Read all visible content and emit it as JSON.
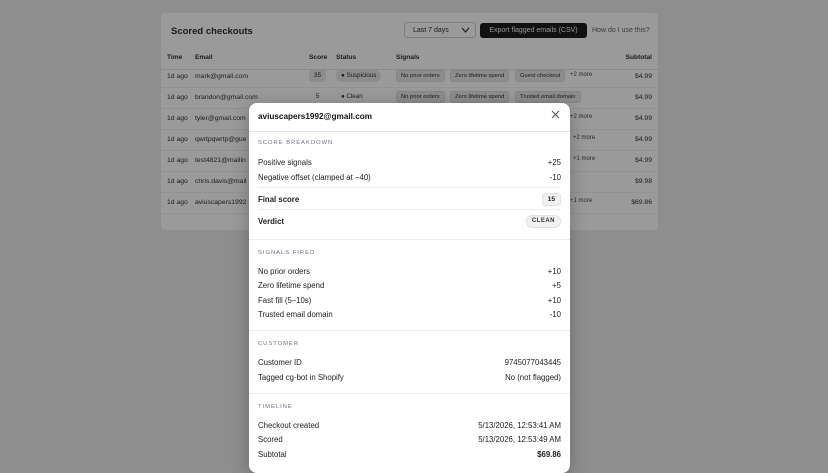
{
  "top_strip": "",
  "card": {
    "title": "Scored checkouts",
    "range_value": "Last 7 days",
    "export_label": "Export flagged emails (CSV)",
    "how_to_label": "How do I use this?"
  },
  "table": {
    "columns": [
      "Time",
      "Email",
      "Score",
      "Status",
      "Signals",
      "Subtotal"
    ],
    "rows": [
      {
        "time": "1d ago",
        "email": "mark@gmail.com",
        "score": "35",
        "status": "Suspicious",
        "signals": [
          "No prior orders",
          "Zero lifetime spend",
          "Guest checkout"
        ],
        "more": "+2 more",
        "subtotal": "$4.99"
      },
      {
        "time": "1d ago",
        "email": "brandon@gmail.com",
        "score": "5",
        "status": "Clean",
        "signals": [
          "No prior orders",
          "Zero lifetime spend",
          "Trusted email domain"
        ],
        "more": "",
        "subtotal": "$4.99"
      },
      {
        "time": "1d ago",
        "email": "tyler@gmail.com",
        "score": "",
        "status": "",
        "signals": [],
        "more": "+2 more",
        "subtotal": "$4.99"
      },
      {
        "time": "1d ago",
        "email": "qwrtpqwrtp@gue",
        "score": "",
        "status": "",
        "signals": [],
        "more": "+2 more",
        "subtotal": "$4.99"
      },
      {
        "time": "1d ago",
        "email": "test4821@mailin",
        "score": "",
        "status": "",
        "signals": [],
        "more": "+1 more",
        "subtotal": "$4.99"
      },
      {
        "time": "1d ago",
        "email": "chris.davis@mail",
        "score": "",
        "status": "",
        "signals": [],
        "more": "",
        "subtotal": "$9.98"
      },
      {
        "time": "1d ago",
        "email": "aviuscapers1992",
        "score": "",
        "status": "",
        "signals": [],
        "more": "+1 more",
        "subtotal": "$69.86"
      }
    ]
  },
  "modal": {
    "title": "aviuscapers1992@gmail.com",
    "score_breakdown": {
      "heading": "SCORE BREAKDOWN",
      "positive_label": "Positive signals",
      "positive_value": "+25",
      "negative_label": "Negative offset (clamped at −40)",
      "negative_value": "-10",
      "final_label": "Final score",
      "final_value": "15",
      "verdict_label": "Verdict",
      "verdict_value": "CLEAN"
    },
    "signals_fired": {
      "heading": "SIGNALS FIRED",
      "items": [
        {
          "label": "No prior orders",
          "value": "+10"
        },
        {
          "label": "Zero lifetime spend",
          "value": "+5"
        },
        {
          "label": "Fast fill (5–10s)",
          "value": "+10"
        },
        {
          "label": "Trusted email domain",
          "value": "-10"
        }
      ]
    },
    "customer": {
      "heading": "CUSTOMER",
      "id_label": "Customer ID",
      "id_value": "9745077043445",
      "tag_label": "Tagged cg-bot in Shopify",
      "tag_value": "No (not flagged)"
    },
    "timeline": {
      "heading": "TIMELINE",
      "created_label": "Checkout created",
      "created_value": "5/13/2026, 12:53:41 AM",
      "scored_label": "Scored",
      "scored_value": "5/13/2026, 12:53:49 AM",
      "subtotal_label": "Subtotal",
      "subtotal_value": "$69.86"
    }
  }
}
